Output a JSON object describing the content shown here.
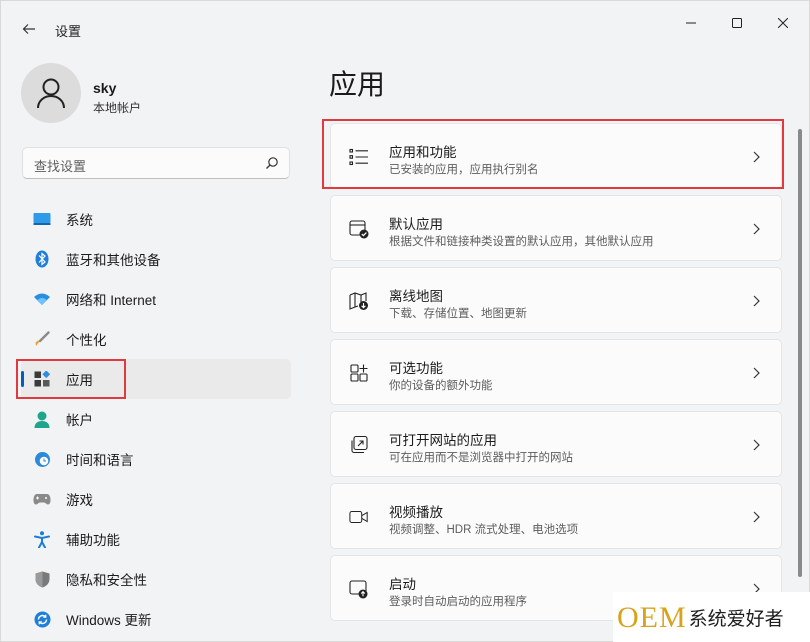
{
  "window": {
    "title": "设置",
    "controls": [
      "minimize",
      "maximize",
      "close"
    ]
  },
  "profile": {
    "name": "sky",
    "account_type": "本地帐户"
  },
  "search": {
    "placeholder": "查找设置"
  },
  "sidebar": {
    "items": [
      {
        "label": "系统",
        "icon": "system-icon",
        "active": false
      },
      {
        "label": "蓝牙和其他设备",
        "icon": "bluetooth-icon",
        "active": false
      },
      {
        "label": "网络和 Internet",
        "icon": "network-icon",
        "active": false
      },
      {
        "label": "个性化",
        "icon": "brush-icon",
        "active": false
      },
      {
        "label": "应用",
        "icon": "apps-icon",
        "active": true
      },
      {
        "label": "帐户",
        "icon": "account-icon",
        "active": false
      },
      {
        "label": "时间和语言",
        "icon": "time-language-icon",
        "active": false
      },
      {
        "label": "游戏",
        "icon": "gaming-icon",
        "active": false
      },
      {
        "label": "辅助功能",
        "icon": "accessibility-icon",
        "active": false
      },
      {
        "label": "隐私和安全性",
        "icon": "shield-icon",
        "active": false
      },
      {
        "label": "Windows 更新",
        "icon": "update-icon",
        "active": false
      }
    ]
  },
  "main": {
    "title": "应用",
    "cards": [
      {
        "title": "应用和功能",
        "desc": "已安装的应用，应用执行别名",
        "icon": "apps-features-icon"
      },
      {
        "title": "默认应用",
        "desc": "根据文件和链接种类设置的默认应用，其他默认应用",
        "icon": "default-apps-icon"
      },
      {
        "title": "离线地图",
        "desc": "下载、存储位置、地图更新",
        "icon": "offline-maps-icon"
      },
      {
        "title": "可选功能",
        "desc": "你的设备的额外功能",
        "icon": "optional-features-icon"
      },
      {
        "title": "可打开网站的应用",
        "desc": "可在应用而不是浏览器中打开的网站",
        "icon": "apps-for-websites-icon"
      },
      {
        "title": "视频播放",
        "desc": "视频调整、HDR 流式处理、电池选项",
        "icon": "video-playback-icon"
      },
      {
        "title": "启动",
        "desc": "登录时自动启动的应用程序",
        "icon": "startup-icon"
      }
    ]
  },
  "watermark": {
    "brand": "OEM",
    "text": "系统爱好者"
  },
  "colors": {
    "accent": "#005fb8",
    "highlight": "#e0393e"
  }
}
